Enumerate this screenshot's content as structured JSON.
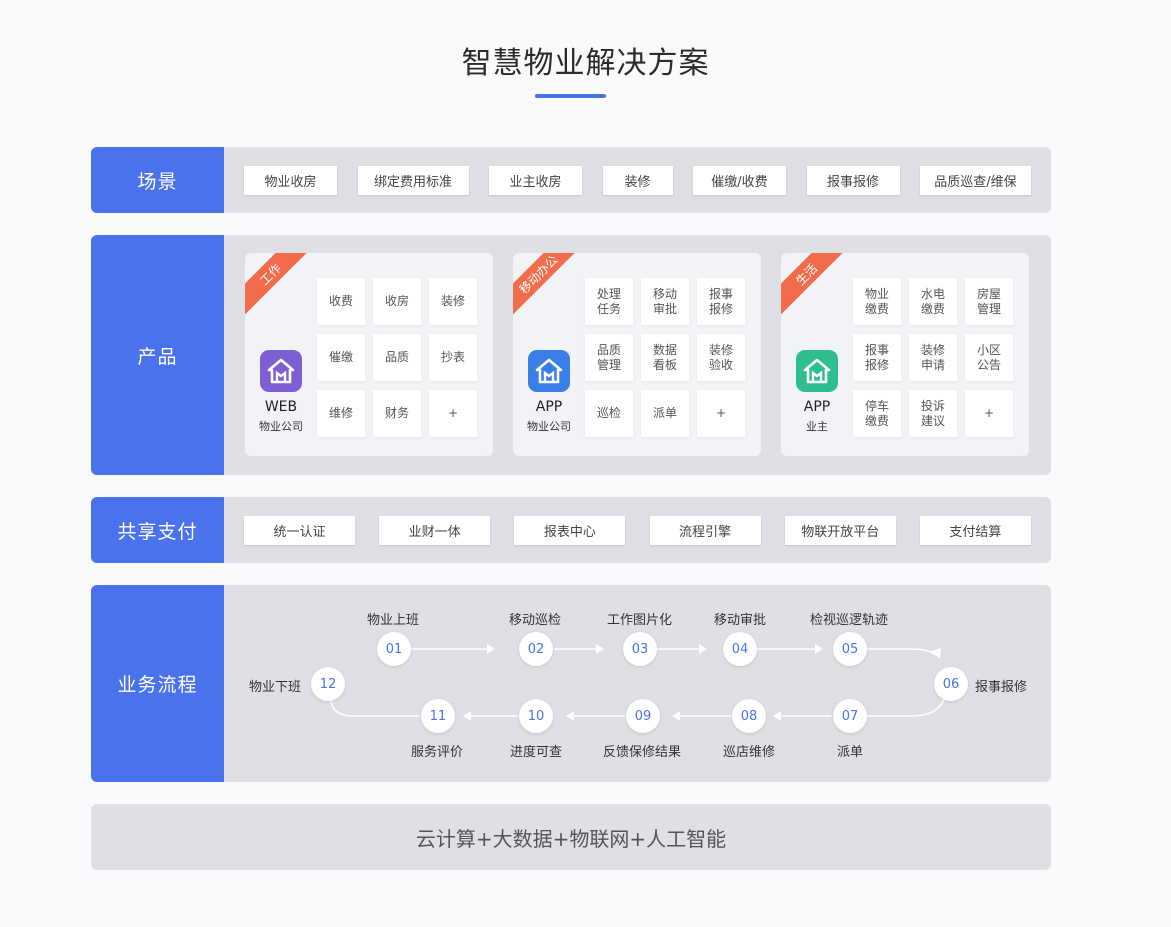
{
  "title": "智慧物业解决方案",
  "colors": {
    "accent": "#4a72ec",
    "ribbon": "#f26b4a",
    "web_icon": "#7e5fd3",
    "app_icon": "#3a7ee8",
    "owner_icon": "#2fbf8f"
  },
  "scenes": {
    "label": "场景",
    "items": [
      "物业收房",
      "绑定费用标准",
      "业主收房",
      "装修",
      "催缴/收费",
      "报事报修",
      "品质巡查/维保"
    ]
  },
  "products": {
    "label": "产品",
    "cards": [
      {
        "ribbon": "工作",
        "icon": "home-icon",
        "name": "WEB",
        "sub": "物业公司",
        "cells": [
          "收费",
          "收房",
          "装修",
          "催缴",
          "品质",
          "抄表",
          "维修",
          "财务",
          "+"
        ]
      },
      {
        "ribbon": "移动办公",
        "icon": "home-icon",
        "name": "APP",
        "sub": "物业公司",
        "cells": [
          "处理\n任务",
          "移动\n审批",
          "报事\n报修",
          "品质\n管理",
          "数据\n看板",
          "装修\n验收",
          "巡检",
          "派单",
          "+"
        ]
      },
      {
        "ribbon": "生活",
        "icon": "home-icon",
        "name": "APP",
        "sub": "业主",
        "cells": [
          "物业\n缴费",
          "水电\n缴费",
          "房屋\n管理",
          "报事\n报修",
          "装修\n申请",
          "小区\n公告",
          "停车\n缴费",
          "投诉\n建议",
          "+"
        ]
      }
    ]
  },
  "payment": {
    "label": "共享支付",
    "items": [
      "统一认证",
      "业财一体",
      "报表中心",
      "流程引擎",
      "物联开放平台",
      "支付结算"
    ]
  },
  "process": {
    "label": "业务流程",
    "steps": [
      {
        "num": "01",
        "label": "物业上班"
      },
      {
        "num": "02",
        "label": "移动巡检"
      },
      {
        "num": "03",
        "label": "工作图片化"
      },
      {
        "num": "04",
        "label": "移动审批"
      },
      {
        "num": "05",
        "label": "检视巡逻轨迹"
      },
      {
        "num": "06",
        "label": "报事报修"
      },
      {
        "num": "07",
        "label": "派单"
      },
      {
        "num": "08",
        "label": "巡店维修"
      },
      {
        "num": "09",
        "label": "反馈保修结果"
      },
      {
        "num": "10",
        "label": "进度可查"
      },
      {
        "num": "11",
        "label": "服务评价"
      },
      {
        "num": "12",
        "label": "物业下班"
      }
    ]
  },
  "foundation": {
    "text": "云计算+大数据+物联网+人工智能"
  }
}
